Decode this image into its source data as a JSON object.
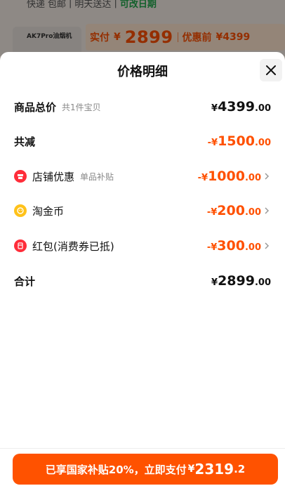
{
  "background": {
    "delivery_text_1": "快递",
    "delivery_text_2": "包邮",
    "delivery_sep": "|",
    "delivery_text_3": "明天送达",
    "delivery_sep2": "|",
    "delivery_green": "可改日期",
    "product_name": "AK7Pro油烟机",
    "paid_label": "实付",
    "paid_symbol": "¥",
    "paid_value": "2899",
    "before_label": "优惠前",
    "before_value": "¥4399"
  },
  "sheet": {
    "title": "价格明细",
    "rows": [
      {
        "label": "商品总价",
        "sub": "共1件宝贝",
        "symbol": "¥",
        "int": "4399",
        "dec": ".00"
      },
      {
        "label": "共减",
        "symbol": "-¥",
        "int": "1500",
        "dec": ".00"
      },
      {
        "label": "店铺优惠",
        "sub": "单品补贴",
        "symbol": "-¥",
        "int": "1000",
        "dec": ".00",
        "icon": "shop-icon"
      },
      {
        "label": "淘金币",
        "symbol": "-¥",
        "int": "200",
        "dec": ".00",
        "icon": "gold-coin-icon"
      },
      {
        "label": "红包(消费券已抵)",
        "symbol": "-¥",
        "int": "300",
        "dec": ".00",
        "icon": "red-packet-icon"
      },
      {
        "label": "合计",
        "symbol": "¥",
        "int": "2899",
        "dec": ".00"
      }
    ]
  },
  "footer": {
    "button_text": "已享国家补贴20%，立即支付",
    "symbol": "¥",
    "int": "2319",
    "dec": ".2"
  },
  "colors": {
    "accent": "#ff5000",
    "button": "#ff5200",
    "green": "#1fa64a"
  }
}
